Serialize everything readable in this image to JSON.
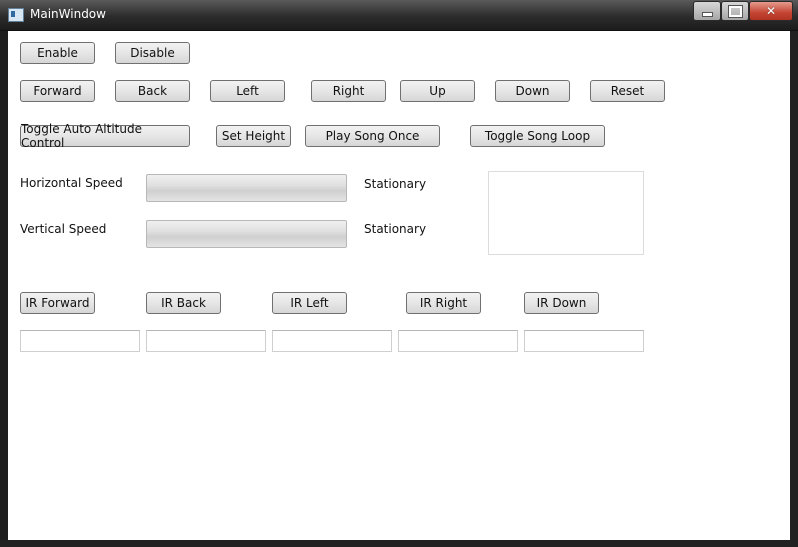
{
  "window": {
    "title": "MainWindow",
    "close_glyph": "✕"
  },
  "buttons_row1": [
    "Enable",
    "Disable"
  ],
  "buttons_row2": [
    "Forward",
    "Back",
    "Left",
    "Right",
    "Up",
    "Down",
    "Reset"
  ],
  "buttons_row3": [
    "Toggle Auto Altitude Control",
    "Set Height",
    "Play Song Once",
    "Toggle Song Loop"
  ],
  "speed": {
    "horizontal_label": "Horizontal Speed",
    "horizontal_status": "Stationary",
    "horizontal_value": 0,
    "vertical_label": "Vertical Speed",
    "vertical_status": "Stationary",
    "vertical_value": 0
  },
  "ir_buttons": [
    "IR Forward",
    "IR Back",
    "IR Left",
    "IR Right",
    "IR Down"
  ],
  "ir_values": [
    "",
    "",
    "",
    "",
    ""
  ]
}
